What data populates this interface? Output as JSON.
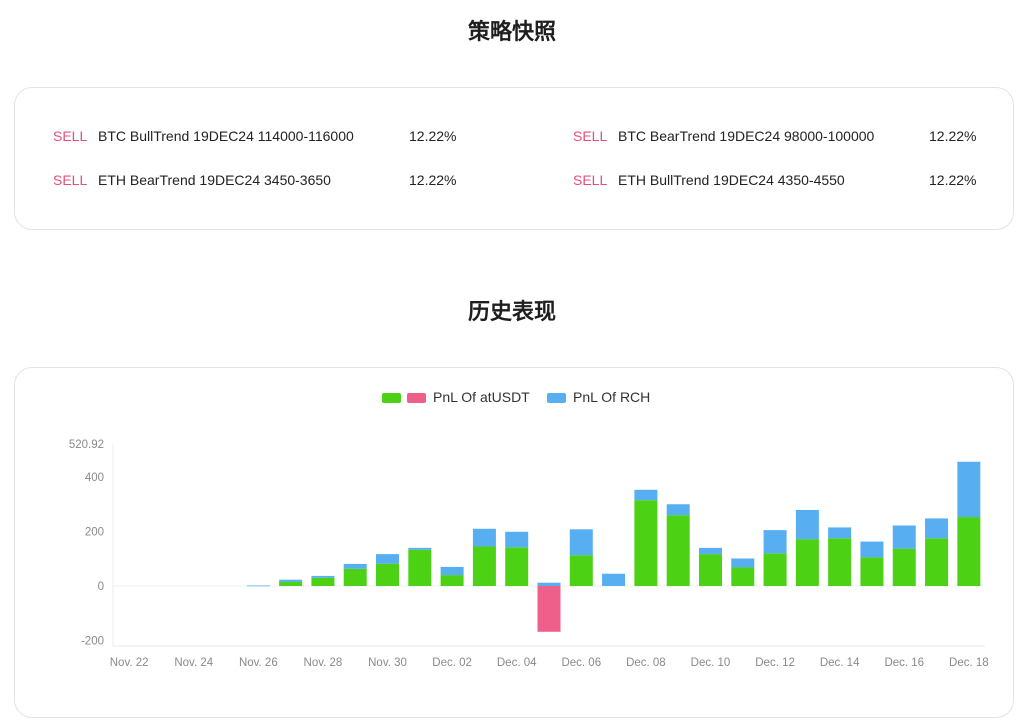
{
  "snapshot": {
    "title": "策略快照",
    "positions": [
      {
        "side": "SELL",
        "name": "BTC BullTrend 19DEC24 114000-116000",
        "pct": "12.22%"
      },
      {
        "side": "SELL",
        "name": "BTC BearTrend 19DEC24 98000-100000",
        "pct": "12.22%"
      },
      {
        "side": "SELL",
        "name": "ETH BearTrend 19DEC24 3450-3650",
        "pct": "12.22%"
      },
      {
        "side": "SELL",
        "name": "ETH BullTrend 19DEC24 4350-4550",
        "pct": "12.22%"
      }
    ]
  },
  "history": {
    "title": "历史表现"
  },
  "colors": {
    "positive": "#4cd115",
    "negative": "#ee5f8a",
    "secondary": "#57aef0",
    "sell": "#e4507c"
  },
  "chart_data": {
    "type": "bar",
    "stacked": true,
    "categories": [
      "Nov. 22",
      "Nov. 23",
      "Nov. 24",
      "Nov. 25",
      "Nov. 26",
      "Nov. 27",
      "Nov. 28",
      "Nov. 29",
      "Nov. 30",
      "Dec. 01",
      "Dec. 02",
      "Dec. 03",
      "Dec. 04",
      "Dec. 05",
      "Dec. 06",
      "Dec. 07",
      "Dec. 08",
      "Dec. 09",
      "Dec. 10",
      "Dec. 11",
      "Dec. 12",
      "Dec. 13",
      "Dec. 14",
      "Dec. 15",
      "Dec. 16",
      "Dec. 17",
      "Dec. 18"
    ],
    "xtick_labels": [
      "Nov. 22",
      "Nov. 24",
      "Nov. 26",
      "Nov. 28",
      "Nov. 30",
      "Dec. 02",
      "Dec. 04",
      "Dec. 06",
      "Dec. 08",
      "Dec. 10",
      "Dec. 12",
      "Dec. 14",
      "Dec. 16",
      "Dec. 18"
    ],
    "series": [
      {
        "name": "PnL Of atUSDT",
        "values": [
          0,
          0,
          0,
          0,
          0,
          15,
          30,
          63,
          82,
          133,
          40,
          145,
          142,
          -168,
          113,
          0,
          315,
          260,
          117,
          68,
          120,
          172,
          175,
          105,
          137,
          175,
          253
        ]
      },
      {
        "name": "PnL Of RCH",
        "values": [
          0,
          0,
          0,
          0,
          2,
          8,
          7,
          18,
          35,
          7,
          30,
          65,
          57,
          12,
          95,
          45,
          38,
          40,
          23,
          33,
          85,
          107,
          40,
          58,
          85,
          73,
          203
        ]
      }
    ],
    "legend_position": "top-center",
    "ylim": [
      -220,
      520.92
    ],
    "yticks": [
      -200,
      0,
      200,
      400,
      520.92
    ],
    "ytick_labels": [
      "-200",
      "0",
      "200",
      "400",
      "520.92"
    ]
  }
}
